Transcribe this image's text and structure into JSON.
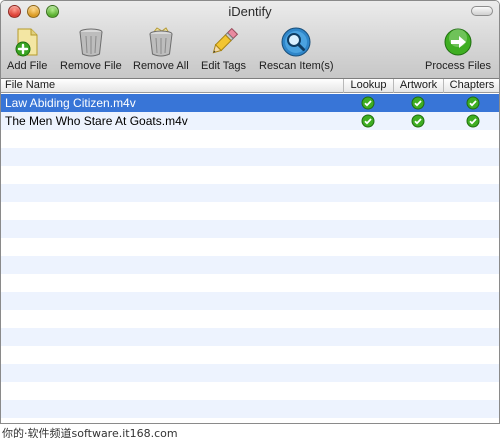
{
  "window": {
    "title": "iDentify"
  },
  "toolbar": {
    "add_file": "Add File",
    "remove_file": "Remove File",
    "remove_all": "Remove All",
    "edit_tags": "Edit Tags",
    "rescan_items": "Rescan Item(s)",
    "process_files": "Process Files"
  },
  "table": {
    "columns": [
      "File Name",
      "Lookup",
      "Artwork",
      "Chapters"
    ],
    "rows": [
      {
        "file_name": "Law Abiding Citizen.m4v",
        "lookup": true,
        "artwork": true,
        "chapters": true,
        "selected": true
      },
      {
        "file_name": "The Men Who Stare At Goats.m4v",
        "lookup": true,
        "artwork": true,
        "chapters": true,
        "selected": false
      }
    ]
  },
  "watermark": "你的·软件频道software.it168.com",
  "colors": {
    "selection": "#3875d7",
    "row_stripe": "#edf3fe",
    "check_green": "#3fae22"
  }
}
